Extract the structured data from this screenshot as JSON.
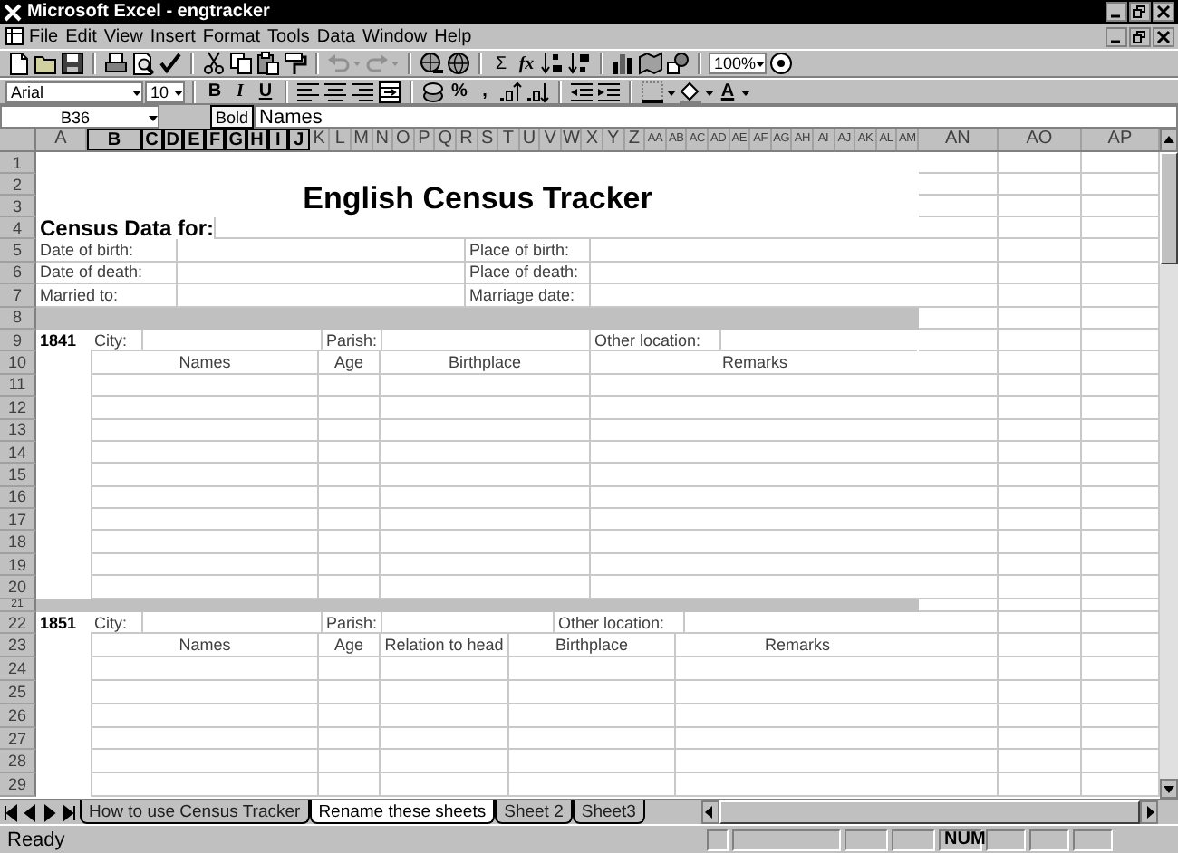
{
  "window": {
    "title": "Microsoft Excel - engtracker"
  },
  "menu": [
    {
      "label": "File"
    },
    {
      "label": "Edit"
    },
    {
      "label": "View"
    },
    {
      "label": "Insert"
    },
    {
      "label": "Format"
    },
    {
      "label": "Tools"
    },
    {
      "label": "Data"
    },
    {
      "label": "Window"
    },
    {
      "label": "Help"
    }
  ],
  "standard_toolbar": {
    "sum": "Σ",
    "function": "fx",
    "zoom": "100%"
  },
  "formatting_toolbar": {
    "font": "Arial",
    "size": "10",
    "bold": "B",
    "italic": "I",
    "underline": "U",
    "percent": "%",
    "comma": ",",
    "font_color": "A"
  },
  "tooltip": "Bold",
  "formula_bar": {
    "cell": "B36",
    "value": "Names"
  },
  "columns": [
    {
      "label": "A",
      "selected": false
    },
    {
      "label": "B",
      "selected": true
    },
    {
      "label": "C",
      "selected": true
    },
    {
      "label": "D",
      "selected": true
    },
    {
      "label": "E",
      "selected": true
    },
    {
      "label": "F",
      "selected": true
    },
    {
      "label": "G",
      "selected": true
    },
    {
      "label": "H",
      "selected": true
    },
    {
      "label": "I",
      "selected": true
    },
    {
      "label": "J",
      "selected": true
    },
    {
      "label": "K",
      "selected": false
    },
    {
      "label": "L",
      "selected": false
    },
    {
      "label": "M",
      "selected": false
    },
    {
      "label": "N",
      "selected": false
    },
    {
      "label": "O",
      "selected": false
    },
    {
      "label": "P",
      "selected": false
    },
    {
      "label": "Q",
      "selected": false
    },
    {
      "label": "R",
      "selected": false
    },
    {
      "label": "S",
      "selected": false
    },
    {
      "label": "T",
      "selected": false
    },
    {
      "label": "U",
      "selected": false
    },
    {
      "label": "V",
      "selected": false
    },
    {
      "label": "W",
      "selected": false
    },
    {
      "label": "X",
      "selected": false
    },
    {
      "label": "Y",
      "selected": false
    },
    {
      "label": "Z",
      "selected": false
    },
    {
      "label": "AA",
      "selected": false
    },
    {
      "label": "AB",
      "selected": false
    },
    {
      "label": "AC",
      "selected": false
    },
    {
      "label": "AD",
      "selected": false
    },
    {
      "label": "AE",
      "selected": false
    },
    {
      "label": "AF",
      "selected": false
    },
    {
      "label": "AG",
      "selected": false
    },
    {
      "label": "AH",
      "selected": false
    },
    {
      "label": "AI",
      "selected": false
    },
    {
      "label": "AJ",
      "selected": false
    },
    {
      "label": "AK",
      "selected": false
    },
    {
      "label": "AL",
      "selected": false
    },
    {
      "label": "AM",
      "selected": false
    }
  ],
  "wide_columns": [
    {
      "label": "AN"
    },
    {
      "label": "AO"
    },
    {
      "label": "AP"
    }
  ],
  "sheet": {
    "blank_row": "1",
    "title": {
      "rows": [
        "2",
        "3"
      ],
      "text": "English Census Tracker"
    },
    "subject": {
      "row": "4",
      "label": "Census Data for:"
    },
    "facts": [
      {
        "row": "5",
        "left": "Date of birth:",
        "right": "Place of birth:"
      },
      {
        "row": "6",
        "left": "Date of death:",
        "right": "Place of death:"
      },
      {
        "row": "7",
        "left": "Married to:",
        "right": "Marriage date:"
      }
    ],
    "census": [
      {
        "band_row": "8",
        "row": "9",
        "year": "1841",
        "city": "City:",
        "parish": "Parish:",
        "other": "Other location:",
        "heading_row": "10",
        "headings": [
          "Names",
          "Age",
          "Birthplace",
          "Remarks"
        ],
        "entry_rows": [
          "11",
          "12",
          "13",
          "14",
          "15",
          "16",
          "17",
          "18",
          "19",
          "20"
        ]
      },
      {
        "band_row": "21",
        "row": "22",
        "year": "1851",
        "city": "City:",
        "parish": "Parish:",
        "other": "Other location:",
        "heading_row": "23",
        "headings": [
          "Names",
          "Age",
          "Relation to head",
          "Birthplace",
          "Remarks"
        ],
        "entry_rows": [
          "24",
          "25",
          "26",
          "27",
          "28",
          "29"
        ]
      }
    ]
  },
  "sheet_tabs": [
    {
      "label": "How to use Census Tracker",
      "selected": false
    },
    {
      "label": "Rename these sheets",
      "selected": true
    },
    {
      "label": "Sheet 2",
      "selected": false
    },
    {
      "label": "Sheet3",
      "selected": false
    }
  ],
  "status_bar": {
    "mode": "Ready",
    "indicator": "NUM"
  }
}
